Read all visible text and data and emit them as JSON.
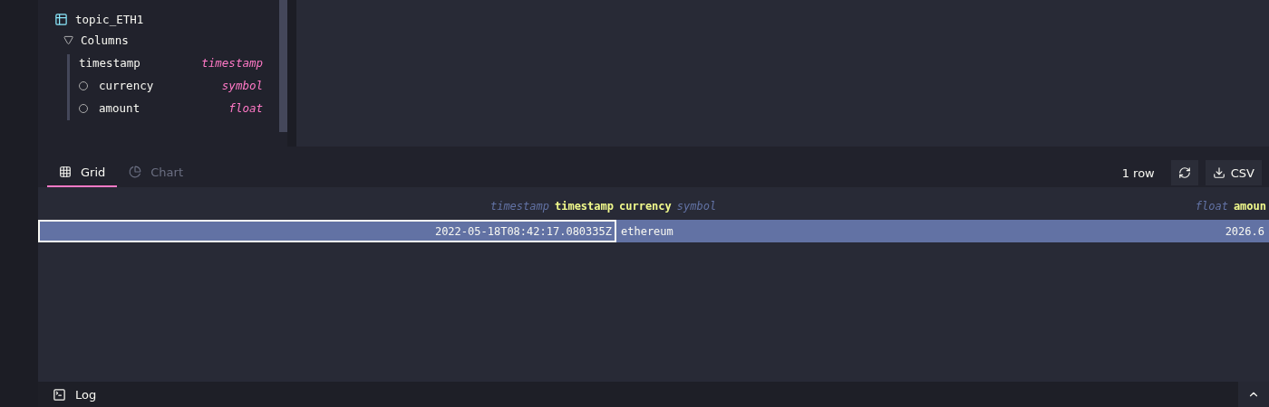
{
  "schema": {
    "table": {
      "name": "topic_ETH1",
      "group": {
        "label": "Columns",
        "expanded": true,
        "columns": [
          {
            "name": "timestamp",
            "type": "timestamp",
            "kind": "designated"
          },
          {
            "name": "currency",
            "type": "symbol",
            "kind": "regular"
          },
          {
            "name": "amount",
            "type": "float",
            "kind": "regular"
          }
        ]
      }
    }
  },
  "results": {
    "tabs": [
      {
        "label": "Grid",
        "selected": true
      },
      {
        "label": "Chart",
        "selected": false
      }
    ],
    "row_count": "1 row",
    "export_label": "CSV",
    "grid": {
      "columns": [
        {
          "name": "timestamp",
          "type": "timestamp",
          "kind": "value"
        },
        {
          "name": "currency",
          "type": "symbol",
          "kind": "text"
        },
        {
          "name": "amoun",
          "type": "float",
          "kind": "value"
        }
      ],
      "rows": [
        {
          "cells": [
            {
              "text": "2022-05-18T08:42:17.080335Z",
              "focused": true
            },
            {
              "text": "ethereum",
              "focused": false
            },
            {
              "text": "2026.6",
              "focused": false
            }
          ],
          "selected": true
        }
      ]
    }
  },
  "log": {
    "label": "Log",
    "expanded": false
  }
}
